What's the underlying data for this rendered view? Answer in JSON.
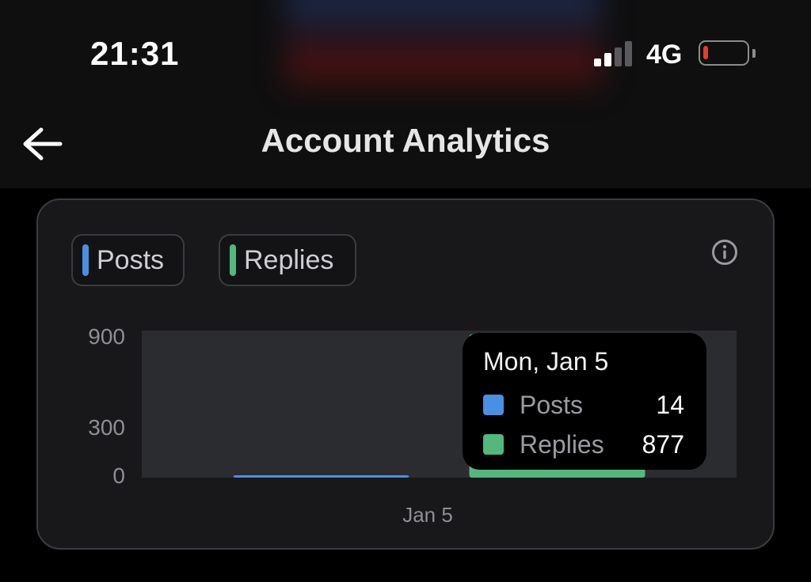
{
  "status_bar": {
    "time": "21:31",
    "network": "4G",
    "battery_level": 0.1,
    "battery_color": "#ea3b2f"
  },
  "header": {
    "title": "Account Analytics",
    "back_icon": "arrow-left-icon"
  },
  "legend": [
    {
      "label": "Posts",
      "color": "#4a90e2"
    },
    {
      "label": "Replies",
      "color": "#52b87c"
    }
  ],
  "info_icon": "info-circle-icon",
  "chart_data": {
    "type": "bar",
    "categories": [
      "Jan 5"
    ],
    "series": [
      {
        "name": "Posts",
        "values": [
          14
        ],
        "color": "#4a90e2"
      },
      {
        "name": "Replies",
        "values": [
          877
        ],
        "color": "#52b87c"
      }
    ],
    "yticks": [
      "900",
      "300",
      "0"
    ],
    "xticks": [
      "Jan 5"
    ],
    "ylim": [
      0,
      900
    ],
    "grid": false
  },
  "tooltip": {
    "date": "Mon, Jan 5",
    "rows": [
      {
        "label": "Posts",
        "value": "14",
        "color": "#4a90e2"
      },
      {
        "label": "Replies",
        "value": "877",
        "color": "#52b87c"
      }
    ]
  }
}
